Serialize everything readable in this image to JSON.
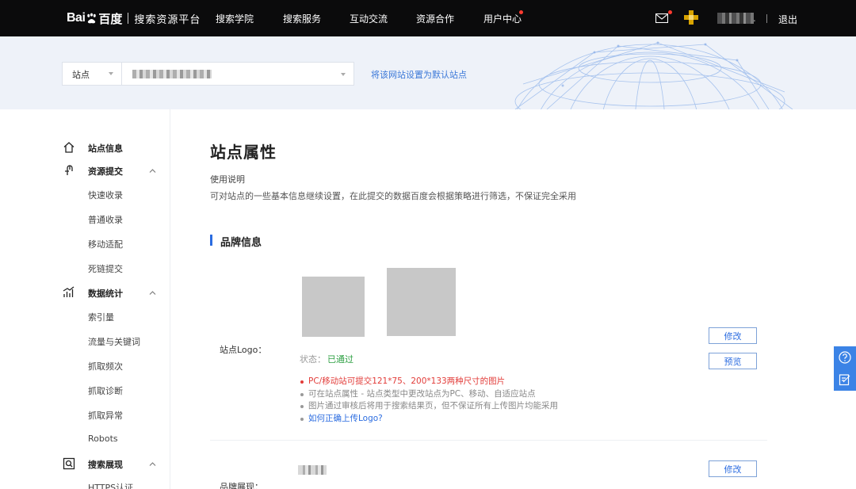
{
  "topnav": {
    "logo_bai": "Bai",
    "logo_du": "百度",
    "platform": "搜索资源平台",
    "links": [
      "搜索学院",
      "搜索服务",
      "互动交流",
      "资源合作",
      "用户中心"
    ],
    "user_trail": ".",
    "logout": "退出"
  },
  "banner": {
    "site_label": "站点",
    "set_default": "将该网站设置为默认站点"
  },
  "sidebar": {
    "groups": [
      {
        "title": "站点信息",
        "icon": "home-icon"
      },
      {
        "title": "资源提交",
        "icon": "submit-icon",
        "items": [
          "快速收录",
          "普通收录",
          "移动适配",
          "死链提交"
        ]
      },
      {
        "title": "数据统计",
        "icon": "chart-icon",
        "items": [
          "索引量",
          "流量与关键词",
          "抓取频次",
          "抓取诊断",
          "抓取异常",
          "Robots"
        ]
      },
      {
        "title": "搜索展现",
        "icon": "search-display-icon",
        "items": [
          "HTTPS认证"
        ]
      }
    ]
  },
  "main": {
    "title": "站点属性",
    "usage_title": "使用说明",
    "usage_desc": "可对站点的一些基本信息继续设置，在此提交的数据百度会根据策略进行筛选，不保证完全采用",
    "section_title": "品牌信息",
    "logo_row": {
      "label": "站点Logo：",
      "status_label": "状态：",
      "status_value": "已通过",
      "notes": [
        "PC/移动站可提交121*75、200*133两种尺寸的图片",
        "可在站点属性 - 站点类型中更改站点为PC、移动、自适应站点",
        "图片通过审核后将用于搜索结果页，但不保证所有上传图片均能采用",
        "如何正确上传Logo?"
      ],
      "edit_button": "修改",
      "preview_button": "预览"
    },
    "brand_row": {
      "label": "品牌展现：",
      "edit_button": "修改"
    }
  },
  "colors": {
    "accent": "#2b6ce0",
    "success": "#2ea043",
    "warning": "#e23c39",
    "nav_bg": "#0b0b0c",
    "banner_bg": "#eef2f9"
  }
}
